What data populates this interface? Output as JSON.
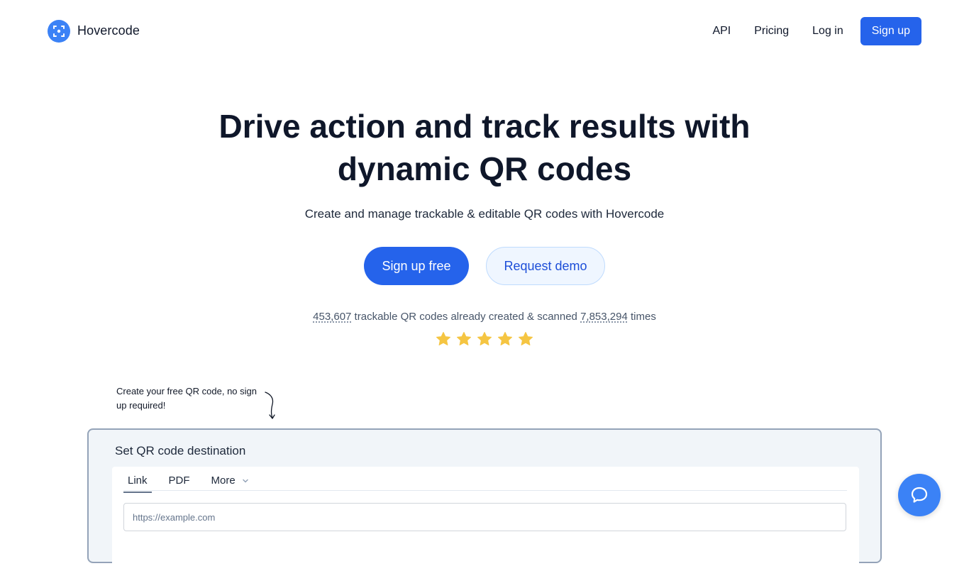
{
  "nav": {
    "brand": "Hovercode",
    "links": [
      "API",
      "Pricing",
      "Log in"
    ],
    "signup": "Sign up"
  },
  "hero": {
    "title_line1": "Drive action and track results with",
    "title_line2": "dynamic QR codes",
    "subtitle": "Create and manage trackable & editable QR codes with Hovercode",
    "cta_primary": "Sign up free",
    "cta_secondary": "Request demo"
  },
  "stats": {
    "codes_count": "453,607",
    "middle_text": " trackable QR codes already created & scanned ",
    "scans_count": "7,853,294",
    "end_text": " times",
    "rating_stars": 5,
    "star_color": "#f5c542"
  },
  "annotation": {
    "text": "Create your free QR code, no sign up required!"
  },
  "qr_panel": {
    "title": "Set QR code destination",
    "tabs": [
      "Link",
      "PDF",
      "More"
    ],
    "active_tab": "Link",
    "url_placeholder": "https://example.com"
  },
  "colors": {
    "primary": "#2563eb",
    "chat_bubble": "#3b82f6"
  },
  "icons": {
    "logo": "scan-frame-icon",
    "tab_more": "chevron-down-icon",
    "chat": "chat-bubble-icon",
    "rating": "star-icon"
  }
}
